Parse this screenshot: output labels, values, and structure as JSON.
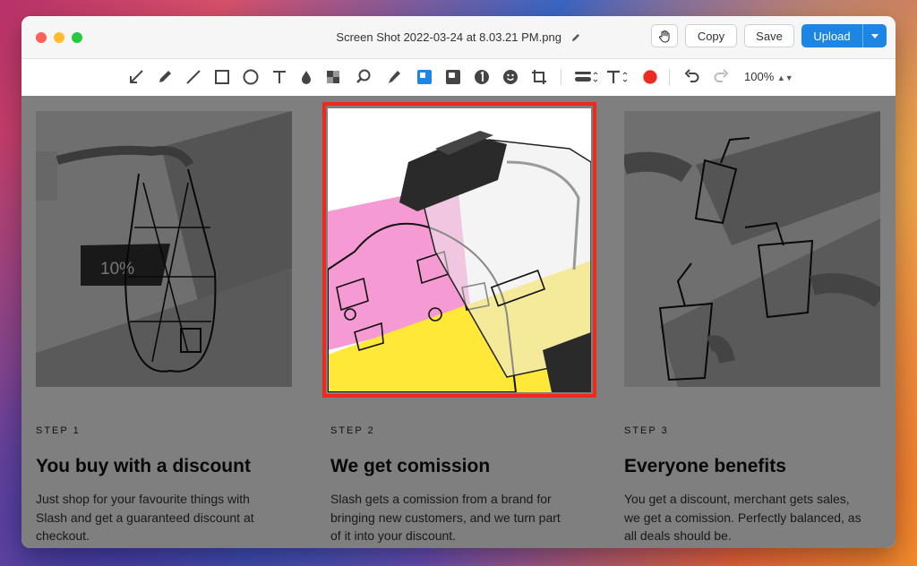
{
  "window": {
    "title": "Screen Shot 2022-03-24 at 8.03.21 PM.png",
    "buttons": {
      "copy": "Copy",
      "save": "Save",
      "upload": "Upload"
    }
  },
  "toolbar": {
    "tools": [
      "arrow-icon",
      "pencil-icon",
      "line-icon",
      "rectangle-icon",
      "ellipse-icon",
      "text-icon",
      "blur-icon",
      "pixelate-icon",
      "magnifier-icon",
      "highlighter-icon",
      "filled-rectangle-icon",
      "spotlight-icon",
      "counter-icon",
      "emoji-icon",
      "crop-icon",
      "line-width-icon",
      "font-size-icon",
      "color-icon",
      "undo-icon",
      "redo-icon"
    ],
    "color": "#ee2a1e",
    "zoom": "100%"
  },
  "content": {
    "steps": [
      {
        "step": "STEP 1",
        "heading": "You buy with a discount",
        "text": "Just shop for your favourite things with Slash and get a guaranteed discount at checkout.",
        "badge": "10%"
      },
      {
        "step": "STEP 2",
        "heading": "We get comission",
        "text": "Slash gets a comission from a brand for bringing new customers, and we turn part of it into your discount."
      },
      {
        "step": "STEP 3",
        "heading": "Everyone benefits",
        "text": "You get a discount, merchant gets sales, we get a comission. Perfectly balanced, as all deals should be."
      }
    ]
  },
  "colors": {
    "accent": "#1d85e3",
    "highlight": "#ee2a1e",
    "pink": "#f59ad2",
    "yellow": "#ffe838"
  }
}
